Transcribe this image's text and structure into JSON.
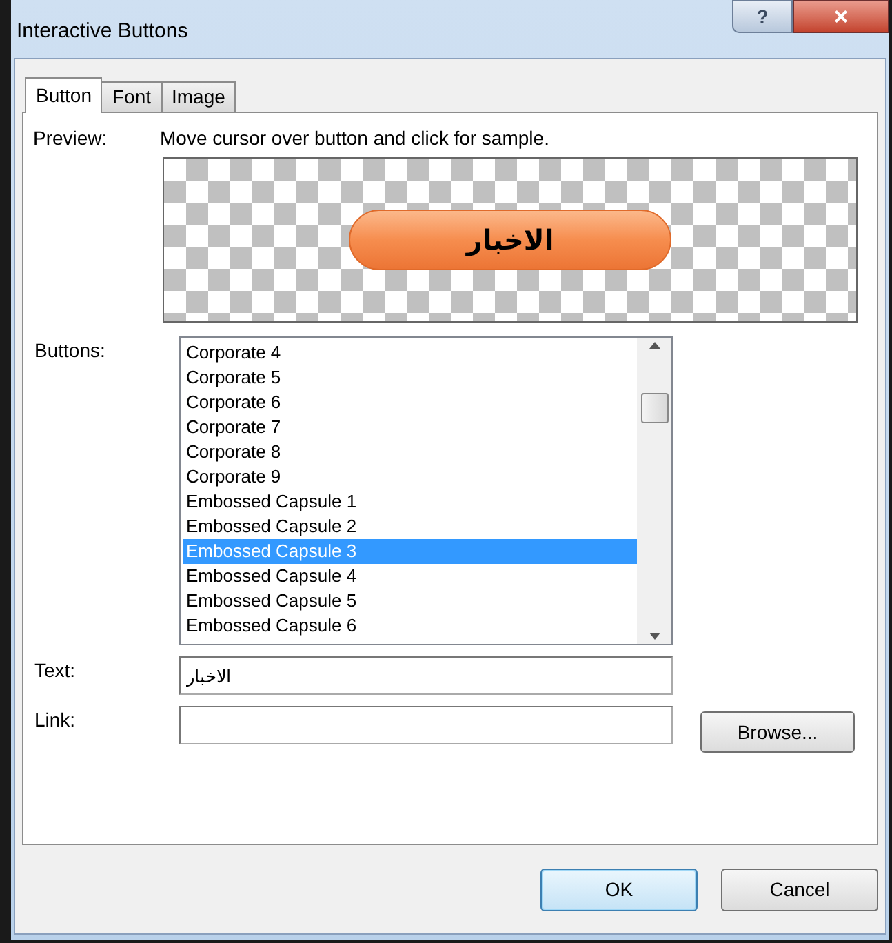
{
  "window": {
    "title": "Interactive Buttons",
    "help": "?",
    "close": "×"
  },
  "tabs": [
    {
      "label": "Button",
      "selected": true
    },
    {
      "label": "Font",
      "selected": false
    },
    {
      "label": "Image",
      "selected": false
    }
  ],
  "preview": {
    "label": "Preview:",
    "hint": "Move cursor over button and click for sample.",
    "button_text": "الاخبار"
  },
  "buttons_list": {
    "label": "Buttons:",
    "items": [
      {
        "label": "Corporate 4",
        "selected": false
      },
      {
        "label": "Corporate 5",
        "selected": false
      },
      {
        "label": "Corporate 6",
        "selected": false
      },
      {
        "label": "Corporate 7",
        "selected": false
      },
      {
        "label": "Corporate 8",
        "selected": false
      },
      {
        "label": "Corporate 9",
        "selected": false
      },
      {
        "label": "Embossed Capsule 1",
        "selected": false
      },
      {
        "label": "Embossed Capsule 2",
        "selected": false
      },
      {
        "label": "Embossed Capsule 3",
        "selected": true
      },
      {
        "label": "Embossed Capsule 4",
        "selected": false
      },
      {
        "label": "Embossed Capsule 5",
        "selected": false
      },
      {
        "label": "Embossed Capsule 6",
        "selected": false
      }
    ]
  },
  "text_field": {
    "label": "Text:",
    "value": "الاخبار"
  },
  "link_field": {
    "label": "Link:",
    "browse": "Browse..."
  },
  "buttons": [
    {
      "label": "OK",
      "kind": "default"
    },
    {
      "label": "Cancel",
      "kind": "normal"
    }
  ]
}
